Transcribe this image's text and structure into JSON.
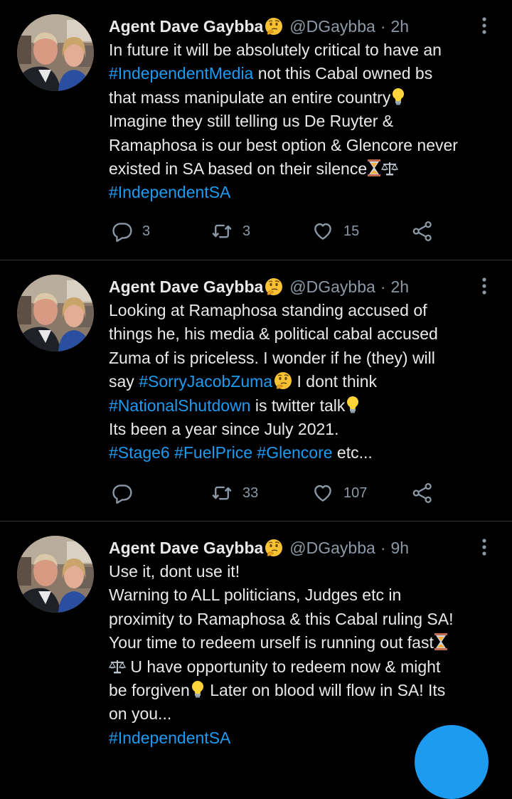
{
  "colors": {
    "background": "#000000",
    "text": "#e7e9ea",
    "secondary": "#8b98a5",
    "link": "#1d9bf0",
    "divider": "#2f3336"
  },
  "tweets": [
    {
      "name": "Agent Dave Gaybba",
      "handle": "@DGaybba",
      "separator": "·",
      "time": "2h",
      "lines": [
        {
          "a": "In future it will be absolutely critical to have an"
        },
        {
          "tag": "#IndependentMedia",
          "b": " not this Cabal owned bs"
        },
        {
          "a": "that mass manipulate an entire country"
        },
        {
          "a": "Imagine they still telling us De Ruyter &"
        },
        {
          "a": "Ramaphosa is our best option & Glencore never"
        },
        {
          "a": "existed in SA based on their silence"
        },
        {
          "tag": "#IndependentSA"
        }
      ],
      "reply_count": "3",
      "retweet_count": "3",
      "like_count": "15"
    },
    {
      "name": "Agent Dave Gaybba",
      "handle": "@DGaybba",
      "separator": "·",
      "time": "2h",
      "lines": [
        {
          "a": "Looking at Ramaphosa standing accused of"
        },
        {
          "a": "things he, his media & political cabal accused"
        },
        {
          "a": "Zuma of is priceless. I wonder if he (they) will"
        },
        {
          "a": "say ",
          "tag": "#SorryJacobZuma",
          "b": " I dont think"
        },
        {
          "tag": "#NationalShutdown",
          "b": " is twitter talk"
        },
        {
          "a": "Its been a year since July 2021."
        },
        {
          "tag": "#Stage6",
          "tag2": "#FuelPrice",
          "tag3": "#Glencore",
          "b": " etc..."
        }
      ],
      "reply_count": "",
      "retweet_count": "33",
      "like_count": "107"
    },
    {
      "name": "Agent Dave Gaybba",
      "handle": "@DGaybba",
      "separator": "·",
      "time": "9h",
      "lines": [
        {
          "a": "Use it, dont use it!"
        },
        {
          "a": "Warning to ALL politicians, Judges etc in"
        },
        {
          "a": "proximity to Ramaphosa & this Cabal ruling SA!"
        },
        {
          "a": "Your time to redeem urself is running out fast"
        },
        {
          "a": " U have opportunity to redeem now & might"
        },
        {
          "a": "be forgiven",
          "b": " Later on blood will flow in SA! Its"
        },
        {
          "a": "on you..."
        },
        {
          "tag": "#IndependentSA"
        }
      ]
    }
  ]
}
